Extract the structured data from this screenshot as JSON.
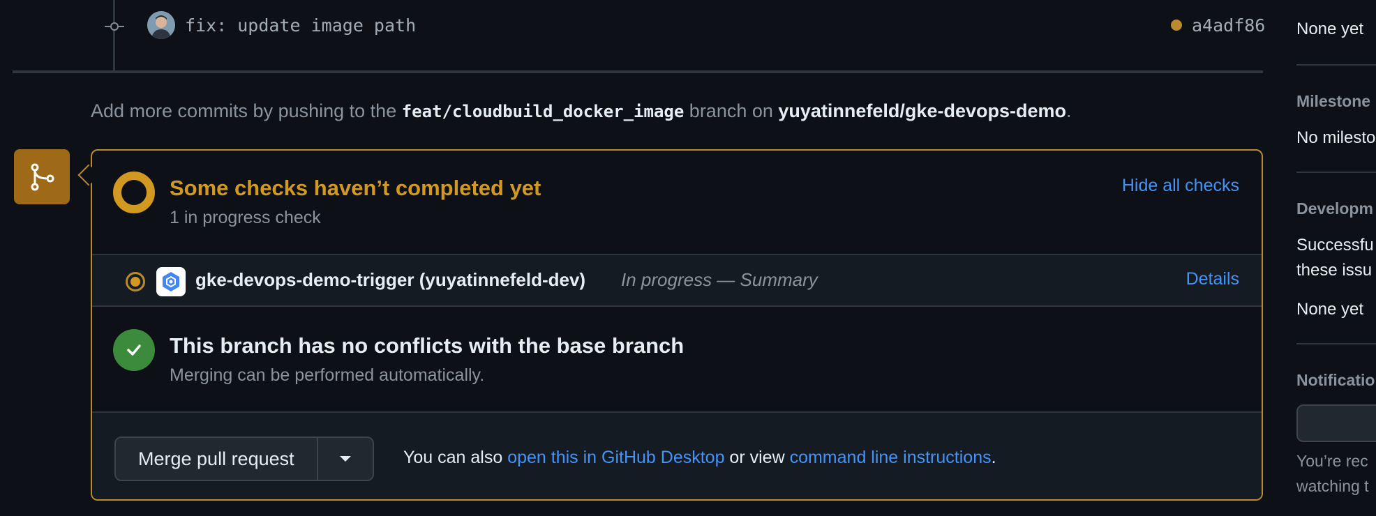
{
  "commit": {
    "message": "fix: update image path",
    "sha": "a4adf86",
    "avatar_icon": "user-avatar",
    "status_color": "#bb8a2c"
  },
  "push_hint": {
    "prefix": "Add more commits by pushing to the ",
    "branch": "feat/cloudbuild_docker_image",
    "middle": " branch on ",
    "repo": "yuyatinnefeld/gke-devops-demo",
    "suffix": "."
  },
  "merge_box": {
    "icon": "git-merge-icon",
    "accent_color": "#d29922",
    "checks": {
      "title": "Some checks haven’t completed yet",
      "subtitle": "1 in progress check",
      "toggle_label": "Hide all checks",
      "items": [
        {
          "name": "gke-devops-demo-trigger (yuyatinnefeld-dev)",
          "status": "In progress — Summary",
          "link_label": "Details",
          "app_icon": "cloud-build-icon"
        }
      ]
    },
    "conflicts": {
      "title": "This branch has no conflicts with the base branch",
      "subtitle": "Merging can be performed automatically."
    },
    "merge": {
      "button_label": "Merge pull request",
      "alt_prefix": "You can also ",
      "desktop_link": "open this in GitHub Desktop",
      "alt_middle": " or view ",
      "cli_link": "command line instructions",
      "alt_suffix": "."
    }
  },
  "sidebar": {
    "reviewers_value": "None yet",
    "milestone_heading": "Milestone",
    "milestone_value": "No milesto",
    "development_heading": "Developm",
    "development_text_1": "Successfu",
    "development_text_2": "these issu",
    "development_value": "None yet",
    "notifications_heading": "Notificatio",
    "notifications_text_1": "You’re rec",
    "notifications_text_2": "watching t"
  }
}
